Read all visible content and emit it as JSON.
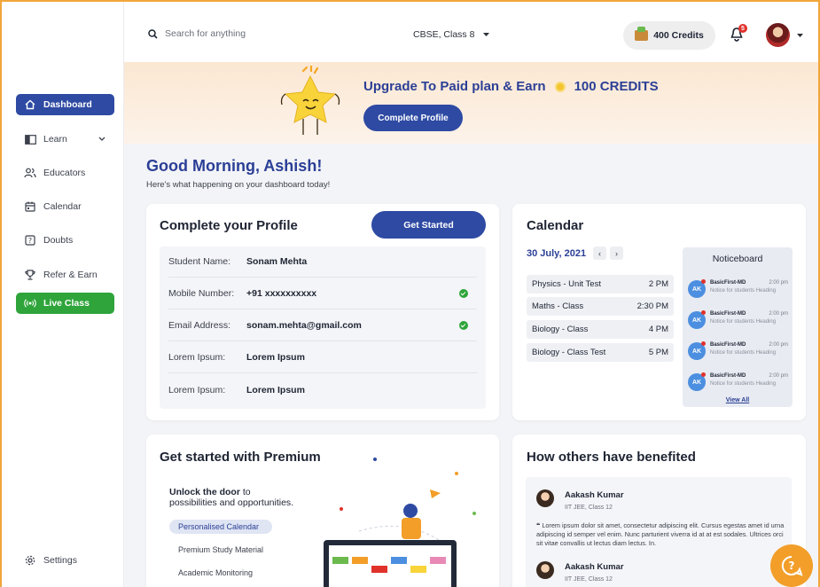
{
  "sidebar": {
    "items": [
      {
        "label": "Dashboard",
        "icon": "home-icon"
      },
      {
        "label": "Learn",
        "icon": "book-icon"
      },
      {
        "label": "Educators",
        "icon": "people-icon"
      },
      {
        "label": "Calendar",
        "icon": "calendar-icon"
      },
      {
        "label": "Doubts",
        "icon": "question-icon"
      },
      {
        "label": "Refer & Earn",
        "icon": "trophy-icon"
      },
      {
        "label": "Live Class",
        "icon": "broadcast-icon"
      }
    ],
    "settings_label": "Settings"
  },
  "topbar": {
    "search_placeholder": "Search for anything",
    "board": "CBSE, Class 8",
    "credits": "400 Credits",
    "notification_count": "5"
  },
  "banner": {
    "title": "Upgrade To Paid plan & Earn",
    "reward": "100 CREDITS",
    "button": "Complete Profile"
  },
  "greeting": {
    "title": "Good Morning, Ashish!",
    "subtitle": "Here's what happening on your dashboard today!"
  },
  "profile": {
    "title": "Complete your Profile",
    "button": "Get Started",
    "rows": [
      {
        "label": "Student Name:",
        "value": "Sonam Mehta",
        "verified": false
      },
      {
        "label": "Mobile Number:",
        "value": "+91 xxxxxxxxxx",
        "verified": true
      },
      {
        "label": "Email Address:",
        "value": "sonam.mehta@gmail.com",
        "verified": true
      },
      {
        "label": "Lorem Ipsum:",
        "value": "Lorem Ipsum",
        "verified": false
      },
      {
        "label": "Lorem Ipsum:",
        "value": "Lorem Ipsum",
        "verified": false
      }
    ]
  },
  "calendar": {
    "title": "Calendar",
    "date": "30 July, 2021",
    "prev": "‹",
    "next": "›",
    "events": [
      {
        "name": "Physics - Unit Test",
        "time": "2 PM"
      },
      {
        "name": "Maths - Class",
        "time": "2:30 PM"
      },
      {
        "name": "Biology - Class",
        "time": "4 PM"
      },
      {
        "name": "Biology - Class Test",
        "time": "5 PM"
      }
    ],
    "noticeboard": {
      "title": "Noticeboard",
      "items": [
        {
          "avatar": "AK",
          "name": "BasicFirst-MD",
          "time": "2:00 pm",
          "desc": "Notice for students Heading"
        },
        {
          "avatar": "AK",
          "name": "BasicFirst-MD",
          "time": "2:00 pm",
          "desc": "Notice for students Heading"
        },
        {
          "avatar": "AK",
          "name": "BasicFirst-MD",
          "time": "2:00 pm",
          "desc": "Notice for students Heading"
        },
        {
          "avatar": "AK",
          "name": "BasicFirst-MD",
          "time": "2:00 pm",
          "desc": "Notice for students Heading"
        }
      ],
      "view_all": "View All"
    }
  },
  "premium": {
    "title": "Get started with Premium",
    "unlock_bold": "Unlock the door",
    "unlock_rest1": " to",
    "unlock_rest2": "possibilities and opportunities.",
    "features": [
      "Personalised Calendar",
      "Premium Study Material",
      "Academic Monitoring"
    ]
  },
  "benefited": {
    "title": "How others have benefited",
    "testimonials": [
      {
        "name": "Aakash Kumar",
        "sub": "IIT JEE, Class 12",
        "quote": "Lorem ipsum dolor sit amet, consectetur adipiscing elit. Cursus egestas amet id urna adipiscing id semper vel enim. Nunc parturient viverra id at at est sodales. Ultrices orci sit vitae convallis ut lectus diam lectus. In."
      },
      {
        "name": "Aakash Kumar",
        "sub": "IIT JEE, Class 12"
      }
    ]
  },
  "colors": {
    "primary": "#2e4aa3",
    "live": "#2ea43a",
    "accent": "#f29e29"
  }
}
